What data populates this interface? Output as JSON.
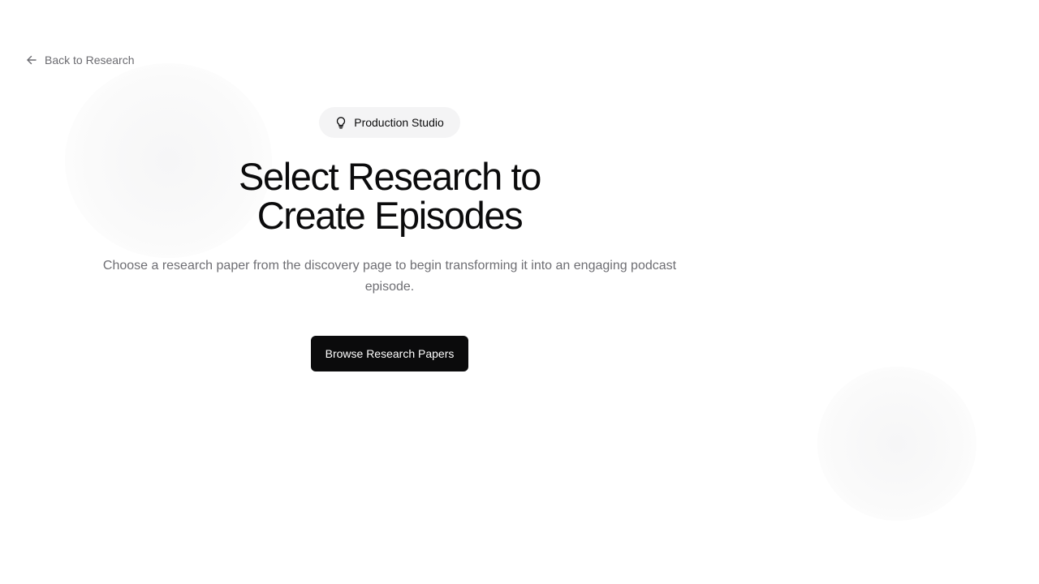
{
  "nav": {
    "back_label": "Back to Research",
    "back_icon": "arrow-left-icon"
  },
  "hero": {
    "badge_label": "Production Studio",
    "badge_icon": "lightbulb-icon",
    "title_line1": "Select Research to",
    "title_line2": "Create Episodes",
    "description": "Choose a research paper from the discovery page to begin transforming it into an engaging podcast episode.",
    "cta_label": "Browse Research Papers"
  },
  "colors": {
    "primary": "#0b0b0c",
    "muted_text": "#6e6e73",
    "badge_bg": "#f4f4f5",
    "background": "#ffffff"
  }
}
